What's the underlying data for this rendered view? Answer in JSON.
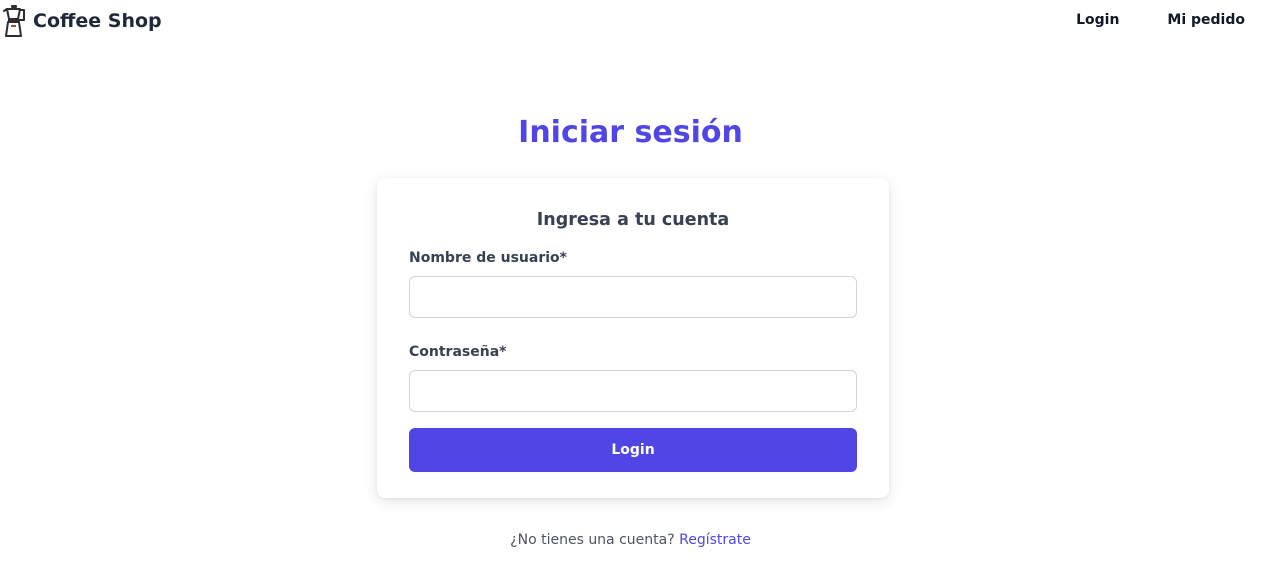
{
  "navbar": {
    "brand_icon": "moka-pot-icon",
    "brand_name": "Coffee Shop",
    "links": [
      {
        "label": "Login"
      },
      {
        "label": "Mi pedido"
      }
    ]
  },
  "page": {
    "title": "Iniciar sesión"
  },
  "login_card": {
    "title": "Ingresa a tu cuenta",
    "username": {
      "label": "Nombre de usuario*",
      "value": ""
    },
    "password": {
      "label": "Contraseña*",
      "value": ""
    },
    "submit_label": "Login"
  },
  "signup": {
    "prompt": "¿No tienes una cuenta?",
    "link_label": "Regístrate"
  },
  "colors": {
    "accent": "#4f46e5",
    "text": "#1f2937"
  }
}
